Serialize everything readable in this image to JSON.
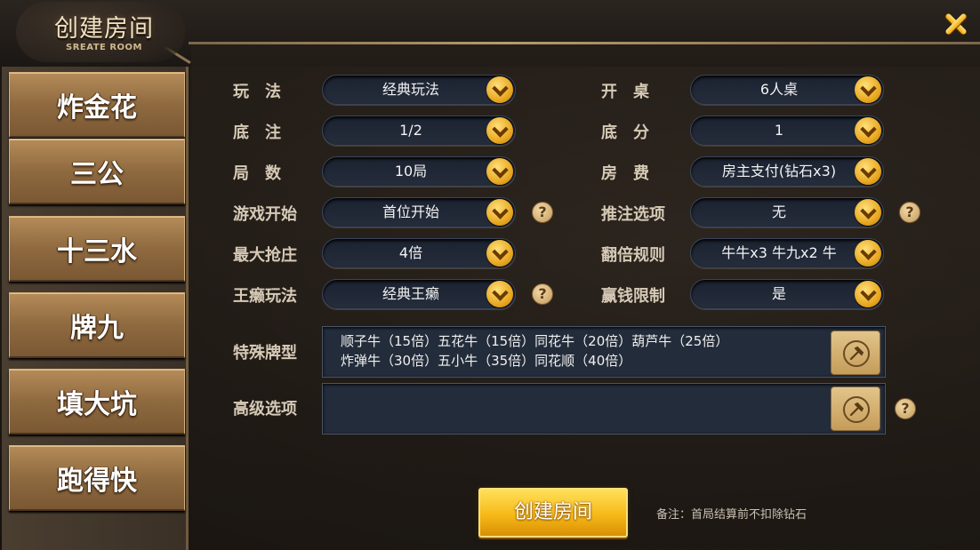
{
  "title": {
    "main": "创建房间",
    "sub": "SREATE ROOM"
  },
  "sidebar": {
    "tabs": [
      "炸金花",
      "三公",
      "十三水",
      "牌九",
      "填大坑",
      "跑得快"
    ]
  },
  "form": {
    "left": [
      {
        "label": "玩　法",
        "value": "经典玩法"
      },
      {
        "label": "底　注",
        "value": "1/2"
      },
      {
        "label": "局　数",
        "value": "10局"
      },
      {
        "label": "游戏开始",
        "value": "首位开始"
      },
      {
        "label": "最大抢庄",
        "value": "4倍"
      },
      {
        "label": "王癞玩法",
        "value": "经典王癞"
      }
    ],
    "right": [
      {
        "label": "开　桌",
        "value": "6人桌"
      },
      {
        "label": "底　分",
        "value": "1"
      },
      {
        "label": "房　费",
        "value": "房主支付(钻石x3)"
      },
      {
        "label": "推注选项",
        "value": "无"
      },
      {
        "label": "翻倍规则",
        "value": "牛牛x3 牛九x2 牛"
      },
      {
        "label": "赢钱限制",
        "value": "是"
      }
    ],
    "special": {
      "label": "特殊牌型",
      "line1": "顺子牛（15倍）五花牛（15倍）同花牛（20倍）葫芦牛（25倍）",
      "line2": "炸弹牛（30倍）五小牛（35倍）同花顺（40倍）"
    },
    "advanced": {
      "label": "高级选项",
      "value": ""
    },
    "help_glyph": "?"
  },
  "footer": {
    "create_label": "创建房间",
    "note": "备注：首局结算前不扣除钻石"
  }
}
